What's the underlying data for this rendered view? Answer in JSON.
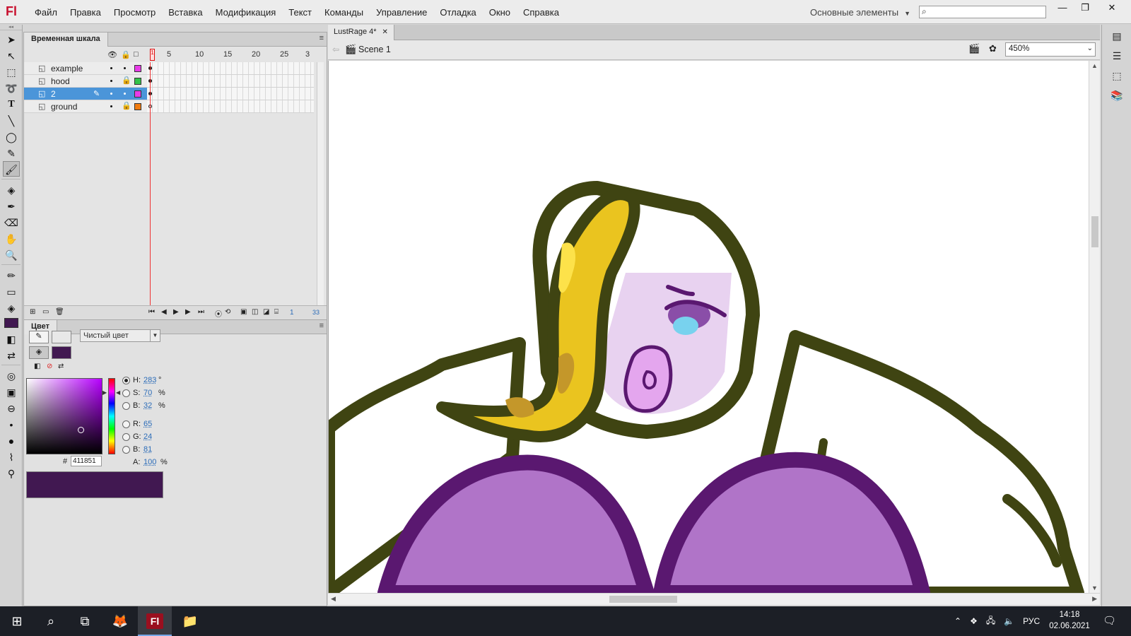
{
  "app": {
    "logo": "Fl",
    "name": "Adobe Animate"
  },
  "menu": [
    "Файл",
    "Правка",
    "Просмотр",
    "Вставка",
    "Модификация",
    "Текст",
    "Команды",
    "Управление",
    "Отладка",
    "Окно",
    "Справка"
  ],
  "workspace": "Основные элементы",
  "search": {
    "value": "",
    "placeholder": ""
  },
  "timeline": {
    "tab": "Временная шкала",
    "frame_numbers": [
      "1",
      "5",
      "10",
      "15",
      "20",
      "25",
      "3"
    ],
    "layers": [
      {
        "name": "example",
        "selected": false,
        "locked": false,
        "color": "#e83be8"
      },
      {
        "name": "hood",
        "selected": false,
        "locked": true,
        "color": "#33c24a"
      },
      {
        "name": "2",
        "selected": true,
        "locked": false,
        "color": "#e83be8"
      },
      {
        "name": "ground",
        "selected": false,
        "locked": true,
        "color": "#f07b10"
      }
    ],
    "current_frame": "1",
    "fps": "33"
  },
  "color_panel": {
    "tab": "Цвет",
    "type": "Чистый цвет",
    "fill_color": "#411851",
    "stroke_color": "#e8e8e8",
    "hsb": {
      "h": "283",
      "s": "70",
      "b": "32"
    },
    "rgb": {
      "r": "65",
      "g": "24",
      "b": "81"
    },
    "alpha": "100",
    "hex_label": "#",
    "hex": "411851",
    "units": {
      "deg": "°",
      "pct": "%"
    }
  },
  "document": {
    "tab": "LustRage 4*",
    "scene": "Scene 1",
    "zoom": "450%"
  },
  "taskbar": {
    "lang": "РУС",
    "time": "14:18",
    "date": "02.06.2021"
  },
  "icons": {
    "tools": [
      "selection-tool-icon",
      "subselection-tool-icon",
      "free-transform-tool-icon",
      "lasso-tool-icon",
      "text-tool-icon",
      "line-tool-icon",
      "oval-tool-icon",
      "pencil-tool-icon",
      "brush-tool-icon",
      "paint-bucket-tool-icon",
      "eyedropper-tool-icon",
      "eraser-tool-icon",
      "hand-tool-icon",
      "zoom-tool-icon"
    ]
  }
}
